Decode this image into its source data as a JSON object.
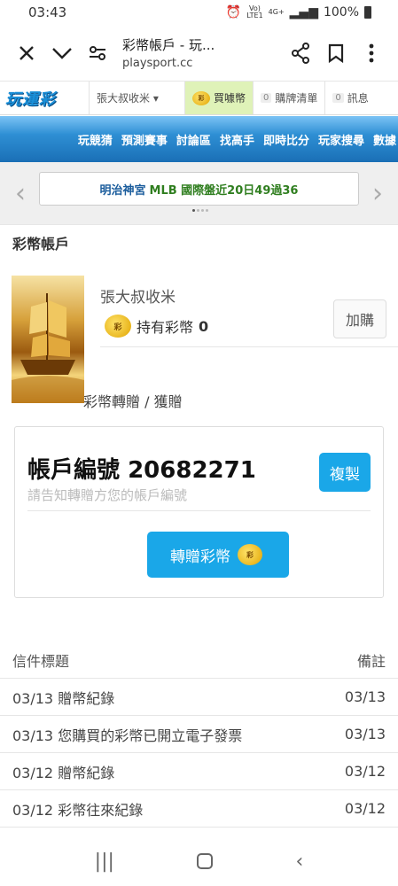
{
  "status": {
    "time": "03:43",
    "net_top": "Vo)",
    "net_mid": "LTE1",
    "net_type": "4G+",
    "battery": "100%"
  },
  "browser": {
    "title": "彩幣帳戶 - 玩...",
    "url": "playsport.cc"
  },
  "site": {
    "logo": "玩運彩",
    "user_menu": "張大叔收米 ▾",
    "buy_coin": "買噱幣",
    "cart_count": "0",
    "cart_label": "購牌清單",
    "msg_count": "0",
    "msg_label": "訊息"
  },
  "nav": {
    "items": [
      "玩競猜",
      "預測賽事",
      "討論區",
      "找高手",
      "即時比分",
      "玩家搜尋",
      "數據"
    ]
  },
  "marquee": {
    "prefix": "明治神宮",
    "text": "MLB 國際盤近20日49過36"
  },
  "page": {
    "title": "彩幣帳戶"
  },
  "profile": {
    "username": "張大叔收米",
    "hold_label": "持有彩幣",
    "hold_value": "0",
    "buy_button": "加購",
    "transfer_label": "彩幣轉贈 / 獲贈"
  },
  "account": {
    "label": "帳戶編號",
    "number": "20682271",
    "copy_button": "複製",
    "hint": "請告知轉贈方您的帳戶編號",
    "gift_button": "轉贈彩幣"
  },
  "mail": {
    "header_title": "信件標題",
    "header_note": "備註",
    "rows": [
      {
        "title": "03/13 贈幣紀錄",
        "note": "03/13"
      },
      {
        "title": "03/13 您購買的彩幣已開立電子發票",
        "note": "03/13"
      },
      {
        "title": "03/12 贈幣紀錄",
        "note": "03/12"
      },
      {
        "title": "03/12 彩幣往來紀錄",
        "note": "03/12"
      }
    ]
  },
  "colors": {
    "accent": "#1aa7e8",
    "nav_blue": "#1a6fb6",
    "buy_bg": "#dff2b8",
    "marquee_green": "#2f7e1f"
  },
  "icons": {
    "close": "close-icon",
    "chevron": "chevron-down-icon",
    "settings": "tune-icon",
    "share": "share-icon",
    "bookmark": "bookmark-icon",
    "more": "more-vert-icon"
  },
  "coin_badge": "彩"
}
